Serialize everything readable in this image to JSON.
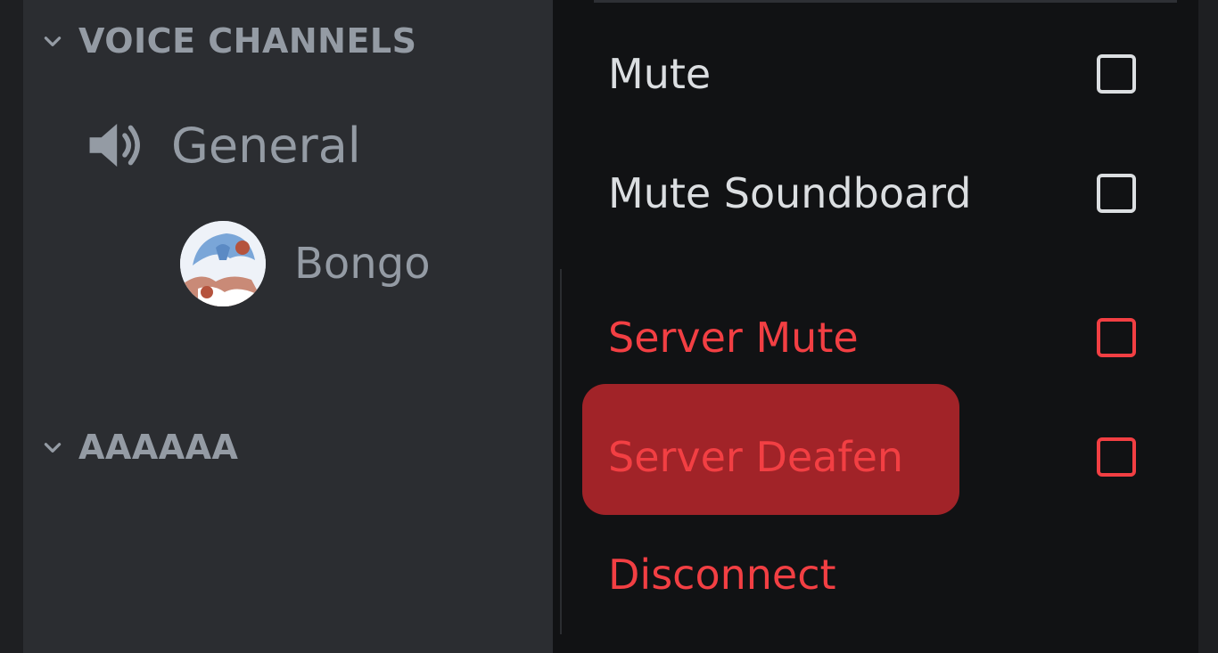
{
  "sidebar": {
    "voice_category_label": "VOICE CHANNELS",
    "voice_channel_name": "General",
    "member_name": "Bongo",
    "second_category_label": "AAAAAA"
  },
  "menu": {
    "items": [
      {
        "label": "Mute",
        "type": "checkbox",
        "checked": false,
        "style": "normal"
      },
      {
        "label": "Mute Soundboard",
        "type": "checkbox",
        "checked": false,
        "style": "normal"
      },
      {
        "label": "Server Mute",
        "type": "checkbox",
        "checked": false,
        "style": "danger"
      },
      {
        "label": "Server Deafen",
        "type": "checkbox",
        "checked": false,
        "style": "danger",
        "hovered": true
      },
      {
        "label": "Disconnect",
        "type": "action",
        "style": "danger"
      }
    ]
  },
  "colors": {
    "sidebar_bg": "#2b2d31",
    "menu_bg": "#111214",
    "text_muted": "#949ba4",
    "text_normal": "#dbdee1",
    "danger": "#f23f43",
    "danger_hover_bg": "#a12328"
  },
  "icons": {
    "chevron": "chevron-down-icon",
    "speaker": "speaker-icon",
    "checkbox": "checkbox-icon"
  }
}
